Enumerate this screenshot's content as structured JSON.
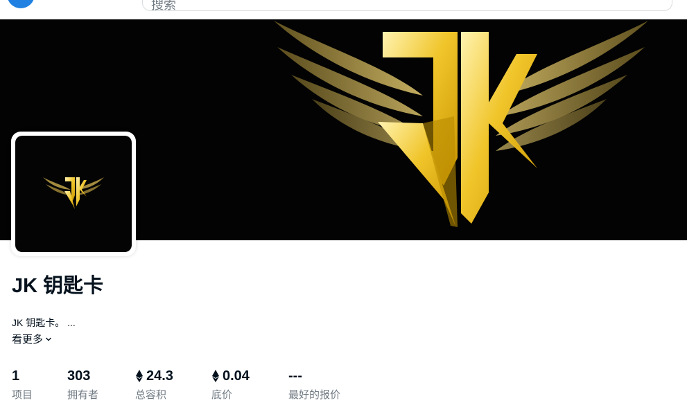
{
  "header": {
    "search_placeholder": "搜索"
  },
  "collection": {
    "title": "JK 钥匙卡",
    "description": "JK 钥匙卡。 ...",
    "see_more_label": "看更多"
  },
  "stats": [
    {
      "value": "1",
      "label": "项目",
      "eth": false
    },
    {
      "value": "303",
      "label": "拥有者",
      "eth": false
    },
    {
      "value": "24.3",
      "label": "总容积",
      "eth": true
    },
    {
      "value": "0.04",
      "label": "底价",
      "eth": true
    },
    {
      "value": "---",
      "label": "最好的报价",
      "eth": false
    }
  ],
  "colors": {
    "brand_blue": "#2081e2",
    "gold": "#e9b51c",
    "text_primary": "#04111d",
    "text_secondary": "#707a83"
  }
}
